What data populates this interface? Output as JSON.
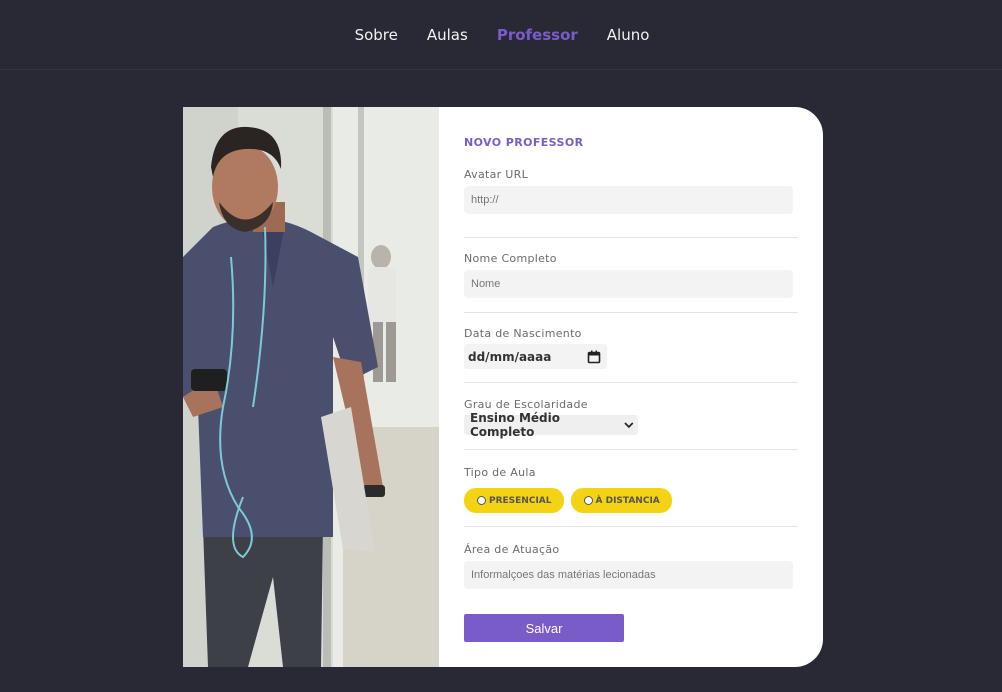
{
  "nav": {
    "items": [
      {
        "label": "Sobre",
        "active": false
      },
      {
        "label": "Aulas",
        "active": false
      },
      {
        "label": "Professor",
        "active": true
      },
      {
        "label": "Aluno",
        "active": false
      }
    ]
  },
  "form": {
    "title": "NOVO PROFESSOR",
    "avatar": {
      "label": "Avatar URL",
      "placeholder": "http://"
    },
    "name": {
      "label": "Nome Completo",
      "placeholder": "Nome"
    },
    "birth": {
      "label": "Data de Nascimento",
      "value": "dd/mm/aaaa"
    },
    "education": {
      "label": "Grau de Escolaridade",
      "selected": "Ensino Médio Completo"
    },
    "class_type": {
      "label": "Tipo de Aula",
      "options": [
        "PRESENCIAL",
        "À DISTANCIA"
      ]
    },
    "area": {
      "label": "Área de Atuação",
      "placeholder": "Informalçoes das matérias lecionadas"
    },
    "save_label": "Salvar"
  },
  "colors": {
    "background": "#282935",
    "accent": "#7a5cc8",
    "pill": "#f3d313"
  }
}
